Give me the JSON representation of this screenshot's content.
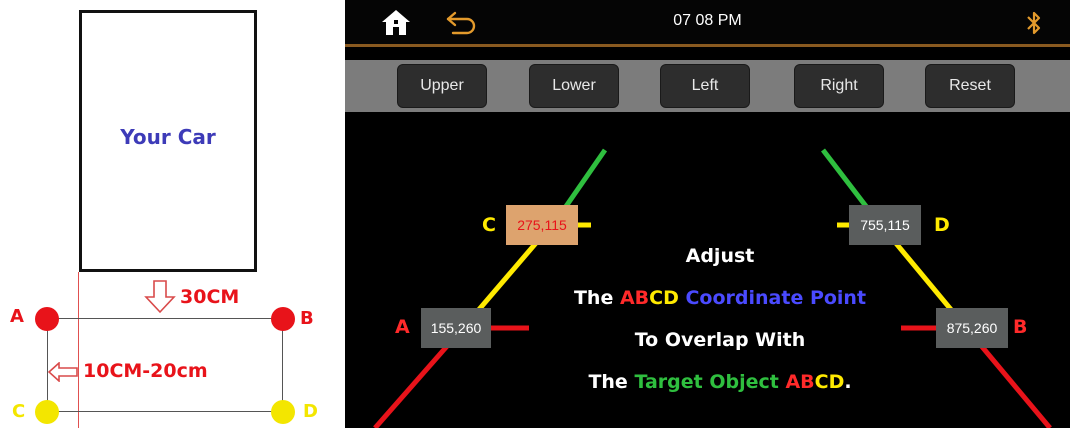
{
  "diagram": {
    "car_label": "Your Car",
    "distance_label": "30CM",
    "offset_label": "10CM-20cm",
    "corner_labels": {
      "a": "A",
      "b": "B",
      "c": "C",
      "d": "D"
    }
  },
  "screen": {
    "status_bar": {
      "time": "07 08  PM"
    },
    "toolbar": {
      "upper": "Upper",
      "lower": "Lower",
      "left": "Left",
      "right": "Right",
      "reset": "Reset"
    },
    "points": {
      "a": {
        "letter": "A",
        "value": "155,260"
      },
      "b": {
        "letter": "B",
        "value": "875,260"
      },
      "c": {
        "letter": "C",
        "value": "275,115"
      },
      "d": {
        "letter": "D",
        "value": "755,115"
      }
    },
    "instructions": {
      "line1": "Adjust",
      "line2_the": "The ",
      "line2_ab": "AB",
      "line2_cd": "CD",
      "line2_rest": " Coordinate Point",
      "line3": "To Overlap With",
      "line4_the": "The ",
      "line4_target": "Target Object ",
      "line4_ab": "AB",
      "line4_cd": "CD",
      "line4_end": "."
    }
  },
  "icons": [
    "home-icon",
    "back-arrow-icon",
    "bluetooth-icon",
    "down-arrow-icon",
    "left-arrow-icon"
  ],
  "colors": {
    "red": "#e8131a",
    "yellow": "#ffea00",
    "green": "#2fbf3f",
    "blue": "#3d3bb8",
    "selected_box": "#dda36e",
    "box": "#5a5d5d",
    "accent_orange": "#e39a2c"
  }
}
